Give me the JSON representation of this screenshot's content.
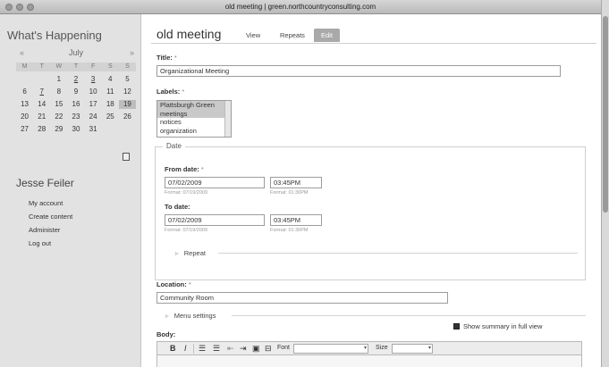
{
  "window": {
    "title": "old meeting | green.northcountryconsulting.com"
  },
  "sidebar": {
    "section_title": "What's Happening",
    "calendar": {
      "month": "July",
      "prev": "«",
      "next": "»",
      "day_headers": [
        "M",
        "T",
        "W",
        "T",
        "F",
        "S",
        "S"
      ],
      "weeks": [
        [
          "",
          "",
          "1",
          "2",
          "3",
          "4",
          "5"
        ],
        [
          "6",
          "7",
          "8",
          "9",
          "10",
          "11",
          "12"
        ],
        [
          "13",
          "14",
          "15",
          "16",
          "17",
          "18",
          "19"
        ],
        [
          "20",
          "21",
          "22",
          "23",
          "24",
          "25",
          "26"
        ],
        [
          "27",
          "28",
          "29",
          "30",
          "31",
          "",
          ""
        ]
      ],
      "linked_days": [
        "2",
        "3",
        "7"
      ],
      "today": "19",
      "icon": "calendar-icon"
    },
    "user_name": "Jesse Feiler",
    "links": [
      "My account",
      "Create content",
      "Administer",
      "Log out"
    ]
  },
  "main": {
    "page_title": "old meeting",
    "tabs": [
      {
        "label": "View",
        "active": false
      },
      {
        "label": "Repeats",
        "active": false
      },
      {
        "label": "Edit",
        "active": true
      }
    ],
    "title_field": {
      "label": "Title:",
      "required": "*",
      "value": "Organizational Meeting"
    },
    "labels_field": {
      "label": "Labels:",
      "required": "*",
      "options": [
        "Plattsburgh Green",
        "meetings",
        "notices",
        "organization"
      ],
      "selected": [
        "Plattsburgh Green",
        "meetings"
      ]
    },
    "date_group": {
      "legend": "Date",
      "from": {
        "label": "From date:",
        "required": "*",
        "date": "07/02/2009",
        "time": "03:45PM",
        "date_format": "Format: 07/19/2009",
        "time_format": "Format: 01:30PM"
      },
      "to": {
        "label": "To date:",
        "date": "07/02/2009",
        "time": "03:45PM",
        "date_format": "Format: 07/19/2009",
        "time_format": "Format: 01:30PM"
      },
      "repeat": "Repeat"
    },
    "location_field": {
      "label": "Location:",
      "required": "*",
      "value": "Community Room"
    },
    "menu_settings": "Menu settings",
    "show_summary": {
      "label": "Show summary in full view",
      "checked": true
    },
    "body": {
      "label": "Body:",
      "toolbar": {
        "bold": "B",
        "italic": "I",
        "font_label": "Font",
        "size_label": "Size"
      }
    }
  }
}
